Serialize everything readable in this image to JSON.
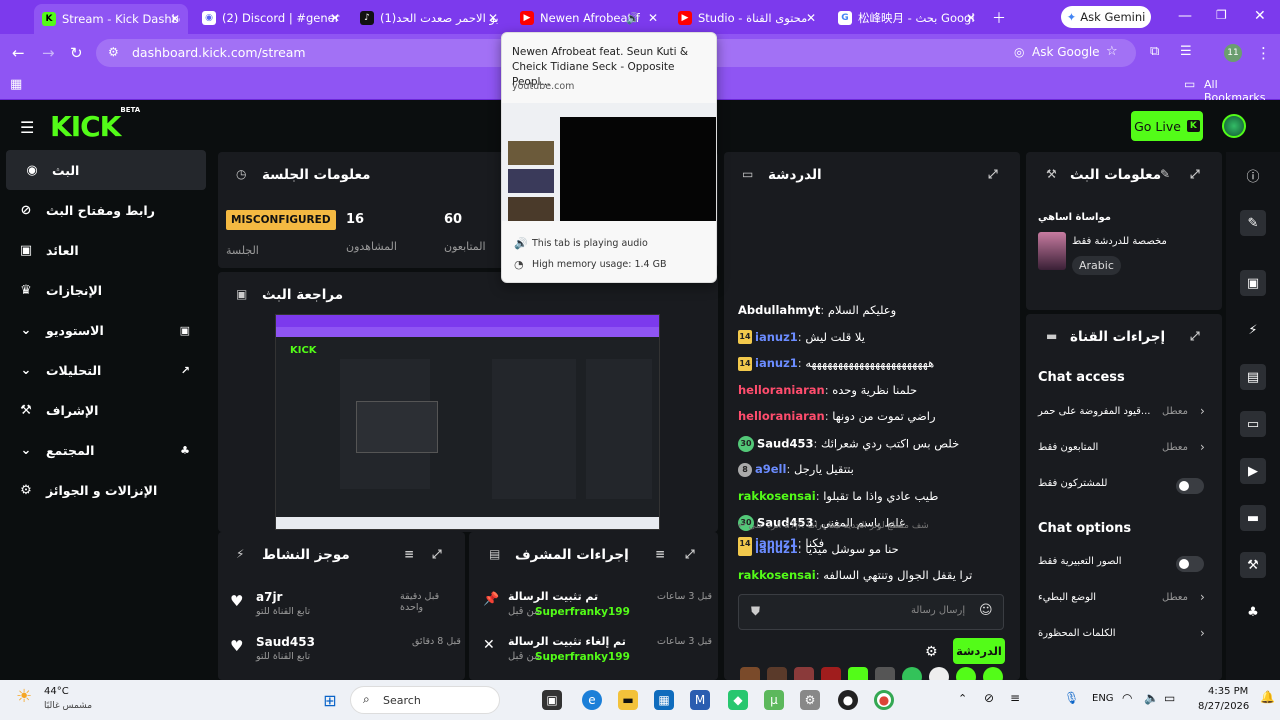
{
  "browser": {
    "tabs": [
      {
        "title": "Stream - Kick Dashbo",
        "icon": "kick-icon",
        "color": "#53fc18"
      },
      {
        "title": "(2) Discord | #general",
        "icon": "discord-icon",
        "color": "#5865f2"
      },
      {
        "title": "(1)ابو الاحمر صعدت الحد",
        "icon": "tiktok-icon",
        "color": "#111111"
      },
      {
        "title": "Newen Afrobeat f",
        "icon": "youtube-icon",
        "color": "#ff0000"
      },
      {
        "title": "Studio - محتوى القناة",
        "icon": "youtube-icon",
        "color": "#ff0000"
      },
      {
        "title": "松峰映月 - بحث Googl",
        "icon": "google-icon",
        "color": "#ffffff"
      }
    ],
    "gemini_label": "Ask Gemini",
    "url": "dashboard.kick.com/stream",
    "ask_google": "Ask Google",
    "profile_initials": "11",
    "all_bookmarks": "All Bookmarks"
  },
  "tab_preview": {
    "title": "Newen Afrobeat feat. Seun Kuti & Cheick Tidiane Seck - Opposite Peopl...",
    "domain": "youtube.com",
    "audio_status": "This tab is playing audio",
    "memory": "High memory usage: 1.4 GB"
  },
  "header": {
    "logo": "KICK",
    "beta": "BETA",
    "go_live": "Go Live"
  },
  "sidebar": {
    "items": [
      {
        "label": "البث",
        "icon": "broadcast-icon"
      },
      {
        "label": "رابط ومفتاح البث",
        "icon": "link-icon"
      },
      {
        "label": "العائد",
        "icon": "revenue-icon"
      },
      {
        "label": "الإنجازات",
        "icon": "trophy-icon"
      },
      {
        "label": "الاستوديو",
        "icon": "studio-icon"
      },
      {
        "label": "التحليلات",
        "icon": "analytics-icon"
      },
      {
        "label": "الإشراف",
        "icon": "moderation-icon"
      },
      {
        "label": "المجتمع",
        "icon": "community-icon"
      },
      {
        "label": "الإنزالات و الجوائز",
        "icon": "drops-icon"
      }
    ]
  },
  "session": {
    "title": "معلومات الجلسة",
    "status": "MISCONFIGURED",
    "status_label": "الجلسة",
    "viewers_value": "16",
    "viewers_label": "المشاهدون",
    "followers_value": "60",
    "followers_label": "المتابعون"
  },
  "preview": {
    "title": "مراجعة البث"
  },
  "activity": {
    "title": "موجز النشاط",
    "items": [
      {
        "user": "a7jr",
        "action": "تابع القناة للتو",
        "time": "قبل دقيقة واحدة"
      },
      {
        "user": "Saud453",
        "action": "تابع القناة للتو",
        "time": "قبل 8 دقائق"
      }
    ]
  },
  "mod_actions": {
    "title": "إجراءات المشرف",
    "items": [
      {
        "action": "تم تثبيت الرسالة",
        "by_prefix": "من قبل",
        "by": "Superfranky199",
        "time": "قبل 3 ساعات"
      },
      {
        "action": "تم إلغاء تثبيت الرسالة",
        "by_prefix": "من قبل",
        "by": "Superfranky199",
        "time": "قبل 3 ساعات"
      }
    ]
  },
  "chat": {
    "title": "الدردشة",
    "messages": [
      {
        "user": "Abdullahmyt",
        "text": "وعليكم السلام",
        "color": "#ffffff",
        "badge": ""
      },
      {
        "user": "ianuz1",
        "text": "يلا قلت ليش",
        "color": "#6b8cff",
        "badge": "14"
      },
      {
        "user": "ianuz1",
        "text": "هههههههههههههههههههههههه",
        "color": "#6b8cff",
        "badge": "14"
      },
      {
        "user": "helloraniaran",
        "text": "حلمنا نظرية وحده",
        "color": "#ff4d6d",
        "badge": ""
      },
      {
        "user": "helloraniaran",
        "text": "راضي تموت من دونها",
        "color": "#ff4d6d",
        "badge": ""
      },
      {
        "user": "Saud453",
        "text": "خلص بس اكتب ردي شعرائك",
        "color": "#ffffff",
        "badge": "30"
      },
      {
        "user": "a9ell",
        "text": "بتتقيل يارجل",
        "color": "#6b8cff",
        "badge": "8"
      },
      {
        "user": "rakkosensai",
        "text": "طيب عادي واذا ما تقبلوا",
        "color": "#53fc18",
        "badge": ""
      },
      {
        "user": "Saud453",
        "text": "غلط باسم المغني",
        "color": "#ffffff",
        "badge": "30"
      },
      {
        "user": "ianuz1",
        "text": "حنا مو سوشل ميديا",
        "color": "#6b8cff",
        "badge": "14"
      },
      {
        "user": "rakkosensai",
        "text": "ترا يقفل الجوال وتنتهي السالفه",
        "color": "#53fc18",
        "badge": ""
      },
      {
        "user": "a7jr",
        "text": "شف مقطع لوتر الجديد تبغا دراما",
        "color": "#6b8cff",
        "badge": ""
      }
    ],
    "reply_hint": "الرد على a7jr: شف مقطع لوتر الجديد تبغا دراما",
    "last_user": "ianuz1",
    "last_text": "فكنا",
    "last_badge": "14",
    "input_placeholder": "إرسال رسالة",
    "send_label": "الدردشة"
  },
  "stream_info": {
    "title": "معلومات البث",
    "stream_title": "مواساة اساهي",
    "subtitle": "مخصصة للدردشة فقط",
    "tag": "Arabic"
  },
  "channel_actions": {
    "title": "إجراءات القناة",
    "chat_access_header": "Chat access",
    "access_rows": [
      {
        "label": "قيود المفروضة على حمر...",
        "value": "معطل"
      },
      {
        "label": "المتابعون فقط",
        "value": "معطل"
      },
      {
        "label": "للمشتركون فقط",
        "value": ""
      }
    ],
    "chat_options_header": "Chat options",
    "option_rows": [
      {
        "label": "الصور التعبيرية فقط",
        "value": ""
      },
      {
        "label": "الوضع البطيء",
        "value": "معطل"
      },
      {
        "label": "الكلمات المحظورة",
        "value": ""
      }
    ]
  },
  "taskbar": {
    "weather_temp": "44°C",
    "weather_desc": "مشمس غالبًا",
    "search": "Search",
    "lang": "ENG",
    "time": "4:35 PM",
    "date": "8/27/2026"
  }
}
